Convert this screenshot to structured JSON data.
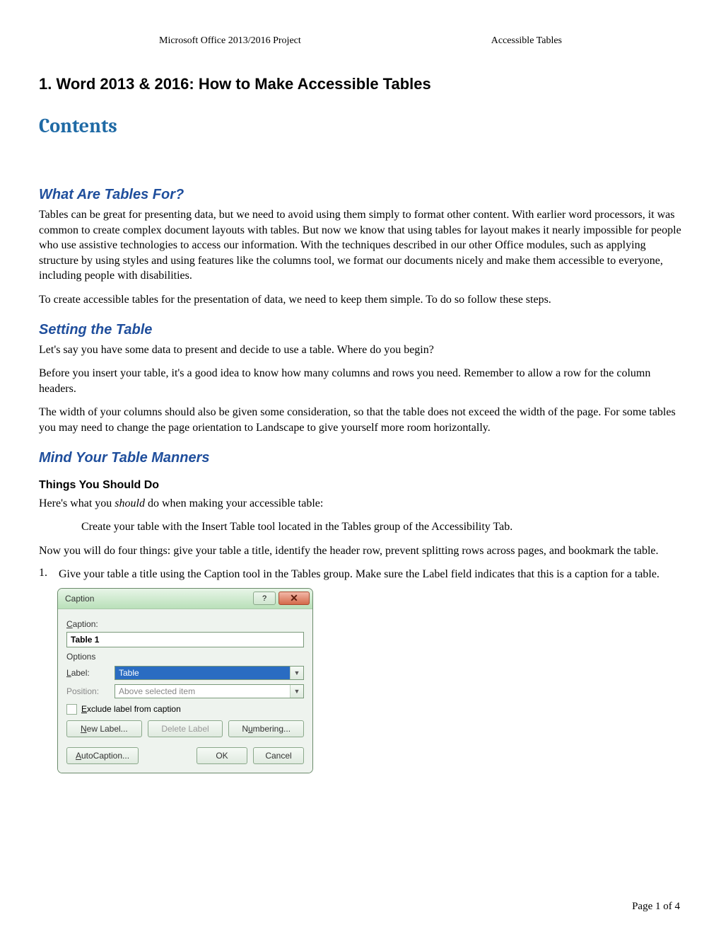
{
  "header": {
    "left": "Microsoft Office 2013/2016 Project",
    "right": "Accessible Tables"
  },
  "title_prefix": "1.",
  "title_text": "Word 2013 & 2016:  How to Make Accessible Tables",
  "contents_heading": "Contents",
  "sections": {
    "s1_title": "What Are Tables For?",
    "s1_p1": "Tables can be great for presenting data, but we need to avoid using them simply to format other content. With earlier word processors, it was common to create complex document layouts with tables. But now we know that using tables for layout makes it nearly impossible for people who use assistive technologies to access our information.  With the techniques described in our other Office modules, such as applying structure by using styles and using features like the columns tool, we format our documents nicely and make them accessible to everyone, including people with disabilities.",
    "s1_p2": "To create accessible tables for the presentation of data, we need to keep them simple. To do so follow these steps.",
    "s2_title": "Setting the Table",
    "s2_p1": "Let's say you have some data to present and decide to use a table. Where do you begin?",
    "s2_p2": "Before you insert your table, it's a good idea to know how many columns and rows you need. Remember to allow a row for the column headers.",
    "s2_p3": "The width of your columns should also be given some consideration, so that the table does not exceed the width of the page. For some tables you may need to change the page orientation to Landscape to give yourself more room horizontally.",
    "s3_title": "Mind Your Table Manners",
    "s3_sub": "Things You Should Do",
    "s3_p1_pre": "Here's what you ",
    "s3_p1_em": "should",
    "s3_p1_post": " do when making your accessible table:",
    "s3_p2": "Create your table with the Insert Table tool located in the Tables group of the Accessibility Tab.",
    "s3_p3": "Now you will do four things: give your table a title, identify the header row, prevent splitting rows across pages, and bookmark the table.",
    "ol1_num": "1.",
    "ol1_text": "Give your table a title using the Caption tool in the Tables group. Make sure the Label field indicates that this is a caption for a table."
  },
  "dialog": {
    "title": "Caption",
    "help_symbol": "?",
    "close_symbol": "✕",
    "caption_label": "Caption:",
    "caption_value": "Table 1",
    "options_group": "Options",
    "label_label": "Label:",
    "label_value": "Table",
    "position_label": "Position:",
    "position_value": "Above selected item",
    "exclude_label": "Exclude label from caption",
    "new_label_btn": "New Label...",
    "delete_label_btn": "Delete Label",
    "numbering_btn": "Numbering...",
    "autocaption_btn": "AutoCaption...",
    "ok_btn": "OK",
    "cancel_btn": "Cancel",
    "dropdown_arrow": "▼"
  },
  "footer": {
    "page_label_pre": "Page ",
    "page_current": "1",
    "page_label_mid": " of ",
    "page_total": "4"
  }
}
